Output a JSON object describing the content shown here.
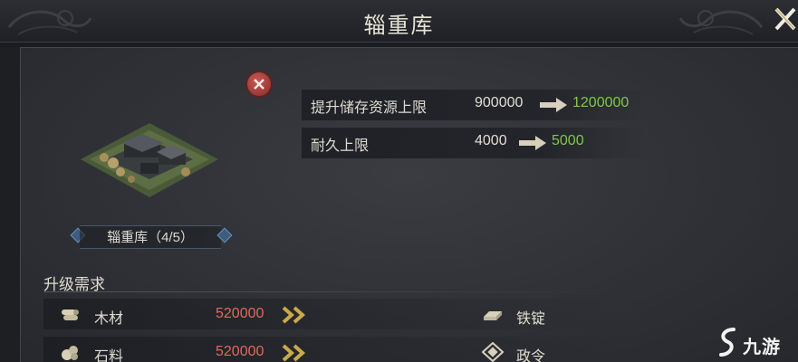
{
  "window": {
    "title": "辎重库",
    "close_icon": "close-x-icon"
  },
  "building": {
    "remove_icon": "remove-x-icon",
    "name_tag": "辎重库（4/5）"
  },
  "stats": [
    {
      "label": "提升储存资源上限",
      "from": "900000",
      "to": "1200000"
    },
    {
      "label": "耐久上限",
      "from": "4000",
      "to": "5000"
    }
  ],
  "requirements": {
    "header": "升级需求",
    "rows": [
      {
        "icon": "wood-icon",
        "name": "木材",
        "amount": "520000",
        "right_icon": "iron-ingot-icon",
        "right_name": "铁锭"
      },
      {
        "icon": "stone-icon",
        "name": "石料",
        "amount": "520000",
        "right_icon": "decree-icon",
        "right_name": "政令"
      }
    ]
  },
  "colors": {
    "upgrade_value": "#7fc84e",
    "insufficient_amount": "#e06a5e"
  },
  "watermark": {
    "text": "九游"
  }
}
